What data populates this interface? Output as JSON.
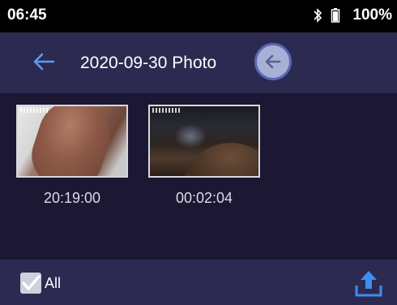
{
  "status_bar": {
    "time": "06:45",
    "battery_text": "100%",
    "icons": [
      "bluetooth-icon",
      "battery-icon"
    ]
  },
  "app_bar": {
    "title": "2020-09-30 Photo",
    "back_icon": "arrow-left-icon",
    "circle_back_icon": "circle-arrow-left-icon"
  },
  "photos": [
    {
      "time": "20:19:00"
    },
    {
      "time": "00:02:04"
    }
  ],
  "bottom_bar": {
    "select_all_label": "All",
    "select_all_checked": true,
    "upload_icon": "upload-icon"
  },
  "colors": {
    "background": "#1c1733",
    "bar": "#2c2a50",
    "accent": "#4a90e2"
  }
}
